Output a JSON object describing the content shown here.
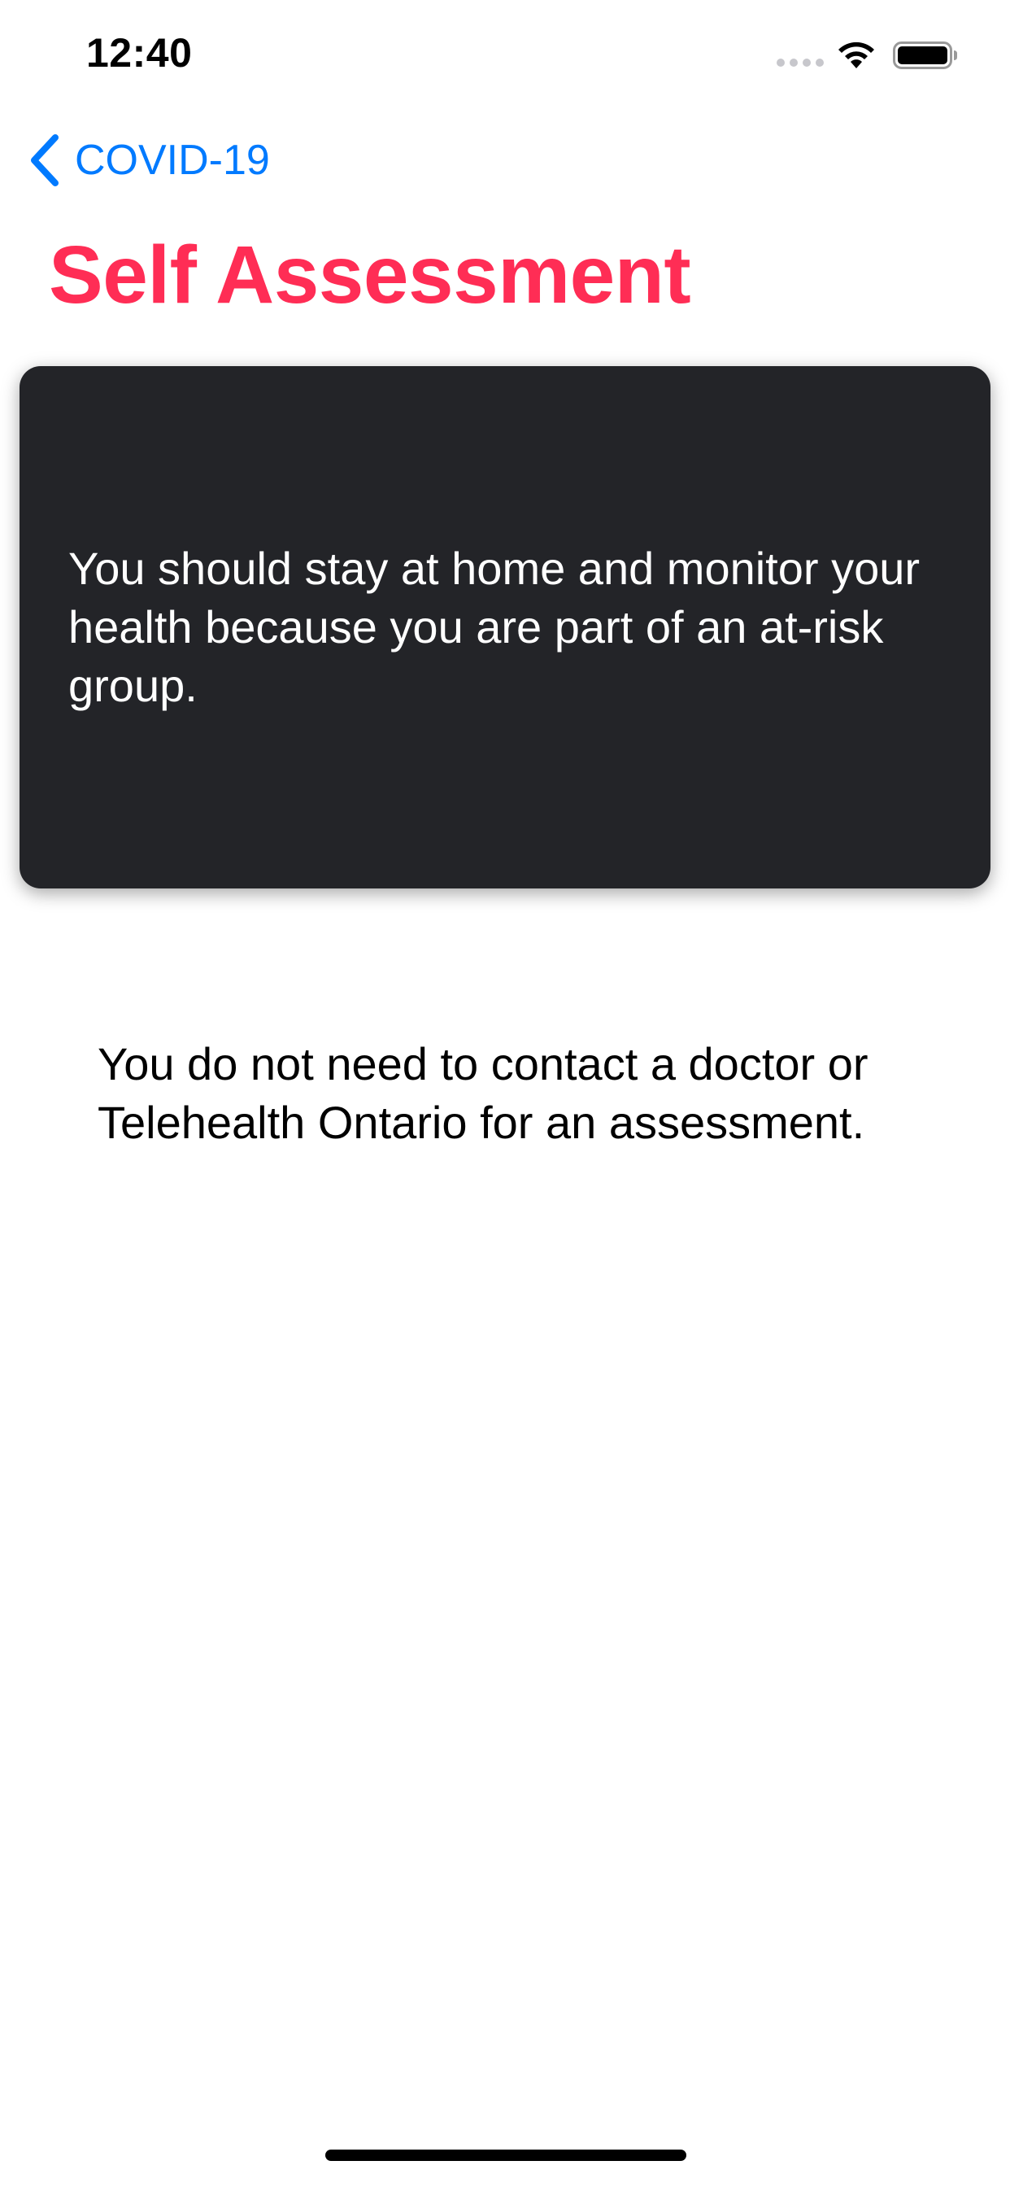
{
  "status_bar": {
    "time": "12:40",
    "icons": [
      "signal-icon",
      "wifi-icon",
      "battery-icon"
    ]
  },
  "navigation": {
    "back_label": "COVID-19",
    "back_icon": "chevron-left-icon",
    "title": "Self Assessment"
  },
  "card": {
    "message": "You should stay at home and monitor your health because you are part of an at-risk group."
  },
  "secondary": {
    "message": "You do not need to contact a doctor or Telehealth Ontario for an assessment."
  },
  "colors": {
    "accent_blue": "#007aff",
    "title_pink": "#ff2d55",
    "card_background": "#232428",
    "page_background": "#ffffff"
  }
}
